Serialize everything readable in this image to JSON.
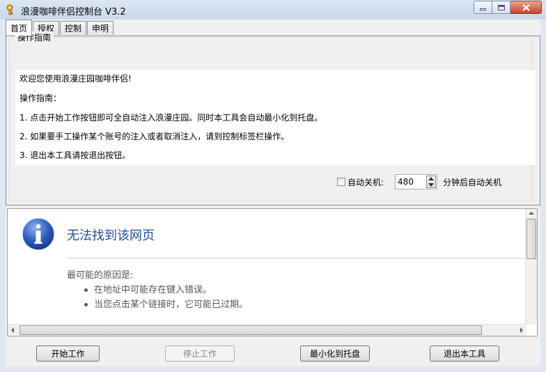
{
  "window": {
    "title": "浪漫咖啡伴侣控制台 V3.2",
    "icon": "key-icon"
  },
  "tabs": [
    {
      "label": "首页",
      "active": true
    },
    {
      "label": "授权",
      "active": false
    },
    {
      "label": "控制",
      "active": false
    },
    {
      "label": "申明",
      "active": false
    }
  ],
  "guide": {
    "group_title": "操作指南",
    "lines": [
      "欢迎您使用浪漫庄园咖啡伴侣!",
      "操作指南：",
      "1. 点击开始工作按钮即可全自动注入浪漫庄园。同时本工具会自动最小化到托盘。",
      "2. 如果要手工操作某个账号的注入或者取消注入，请到控制标签栏操作。",
      "3. 退出本工具请按退出按钮。"
    ]
  },
  "shutdown": {
    "checkbox_label": "自动关机:",
    "checked": false,
    "minutes": "480",
    "suffix": "分钟后自动关机"
  },
  "browser": {
    "error_title": "无法找到该网页",
    "reason_heading": "最可能的原因是:",
    "reasons": [
      "在地址中可能存在键入错误。",
      "当您点击某个链接时，它可能已过期。"
    ],
    "icon": "info-icon"
  },
  "buttons": {
    "start": "开始工作",
    "stop": "停止工作",
    "minimize_tray": "最小化到托盘",
    "exit": "退出本工具"
  },
  "colors": {
    "title_blue": "#1f4e9c",
    "info_blue": "#2d5fbf"
  }
}
